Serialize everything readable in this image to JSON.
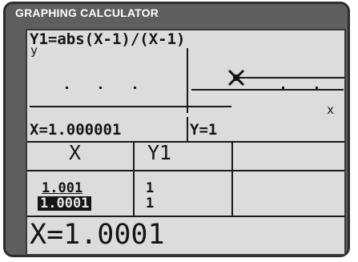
{
  "header": {
    "title": "GRAPHING CALCULATOR"
  },
  "graph": {
    "function": "Y1=abs(X-1)/(X-1)",
    "y_axis_label": "y",
    "x_axis_label": "x",
    "trace_x": "X=1.000001",
    "trace_y": "Y=1",
    "cursor_icon": "trace-cursor-icon"
  },
  "table": {
    "headers": [
      "X",
      "Y1"
    ],
    "rows": [
      {
        "x": "1.001",
        "y": "1"
      },
      {
        "x": "1.0001",
        "y": "1"
      }
    ],
    "selected_row": 1
  },
  "footer": {
    "entry": "X=1.0001"
  }
}
